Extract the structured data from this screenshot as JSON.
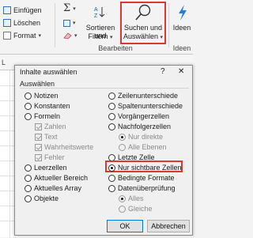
{
  "ribbon": {
    "insert_label": "Einfügen",
    "delete_label": "Löschen",
    "format_label": "Format",
    "sort_label_1": "Sortieren und",
    "sort_label_2": "Filtern",
    "find_label_1": "Suchen und",
    "find_label_2": "Auswählen",
    "ideas_label": "Ideen",
    "group_edit": "Bearbeiten",
    "group_ideas": "Ideen"
  },
  "sheet": {
    "column_header": "L"
  },
  "dialog": {
    "title": "Inhalte auswählen",
    "help_glyph": "?",
    "close_glyph": "✕",
    "group_label": "Auswählen",
    "left_options": [
      {
        "label": "Notizen",
        "state": "off",
        "disabled": false
      },
      {
        "label": "Konstanten",
        "state": "off",
        "disabled": false
      },
      {
        "label": "Formeln",
        "state": "off",
        "disabled": false
      },
      {
        "label": "Zahlen",
        "checked": true,
        "disabled": true
      },
      {
        "label": "Text",
        "checked": true,
        "disabled": true
      },
      {
        "label": "Wahrheitswerte",
        "checked": true,
        "disabled": true
      },
      {
        "label": "Fehler",
        "checked": true,
        "disabled": true
      },
      {
        "label": "Leerzellen",
        "state": "off",
        "disabled": false
      },
      {
        "label": "Aktueller Bereich",
        "state": "off",
        "disabled": false
      },
      {
        "label": "Aktuelles Array",
        "state": "off",
        "disabled": false
      },
      {
        "label": "Objekte",
        "state": "off",
        "disabled": false
      }
    ],
    "right_options": [
      {
        "label": "Zeilenunterschiede",
        "state": "off",
        "disabled": false
      },
      {
        "label": "Spaltenunterschiede",
        "state": "off",
        "disabled": false
      },
      {
        "label": "Vorgängerzellen",
        "state": "off",
        "disabled": false
      },
      {
        "label": "Nachfolgerzellen",
        "state": "off",
        "disabled": false
      },
      {
        "label": "Nur direkte",
        "state": "on",
        "disabled": true
      },
      {
        "label": "Alle Ebenen",
        "state": "off",
        "disabled": true
      },
      {
        "label": "Letzte Zelle",
        "state": "off",
        "disabled": false
      },
      {
        "label": "Nur sichtbare Zellen",
        "state": "on",
        "disabled": false
      },
      {
        "label": "Bedingte Formate",
        "state": "off",
        "disabled": false
      },
      {
        "label": "Datenüberprüfung",
        "state": "off",
        "disabled": false
      },
      {
        "label": "Alles",
        "state": "on",
        "disabled": true
      },
      {
        "label": "Gleiche",
        "state": "off",
        "disabled": true
      }
    ],
    "ok_label": "OK",
    "cancel_label": "Abbrechen"
  },
  "colors": {
    "highlight": "#d83a33",
    "accent": "#0078d7"
  }
}
